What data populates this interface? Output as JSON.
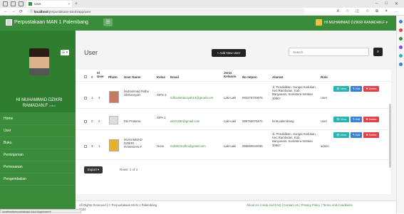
{
  "browser": {
    "tab_title": "User",
    "url_host": "localhost",
    "url_path": "/perpustakaan-tokoh/app/user",
    "win_controls": [
      "–",
      "□",
      "✕"
    ]
  },
  "header": {
    "brand": "Perpustakaan MAN 1 Palembang",
    "menu_toggle": "☰",
    "user": "HI MUHAMMAD DZIKRI RAMADAN.F ▾"
  },
  "sidebar": {
    "profile_button": "☰ ▾",
    "profile_name": "HI MUHAMMAD DZIKRI RAMADAN.F",
    "status": "online",
    "items": [
      "Home",
      "User",
      "Buku",
      "Peminjaman",
      "Pemesanan",
      "Pengembalian"
    ]
  },
  "main": {
    "title": "User",
    "add_button": "+ Add New User",
    "search_placeholder": "Search",
    "search_icon": "🔍",
    "columns": [
      "#",
      "Id User",
      "Photo",
      "User Name",
      "Kelas",
      "Email",
      "Jenis Kelamin",
      "No telpon",
      "Alamat",
      "Role"
    ],
    "rows": [
      {
        "no": "1",
        "id": "3",
        "username": "Muhammad Ridho Oktriansyah",
        "kelas": "XIPS 3",
        "email": "ridhooktriansyah13@gmail.com",
        "gender": "Laki-Laki",
        "phone": "082278700076",
        "alamat": "Jl. Pendidikan, Sungai Kedukan, Kec.Rambutan, Kab. Banyuasin, Sumatera Selatan 30967",
        "role": "User"
      },
      {
        "no": "2",
        "id": "2",
        "username": "Eki Pratama",
        "kelas": "XIPA 1",
        "email": "eki01382@gmail.com",
        "gender": "Laki-Laki",
        "phone": "089758076574",
        "alamat": "km9 palembang",
        "role": "User"
      },
      {
        "no": "3",
        "id": "1",
        "username": "MUHAMMAD DZIKRI RAMADAN.F",
        "kelas": "None",
        "email": "mdzikrirmdhn@gmail.com",
        "gender": "Laki-Laki",
        "phone": "085669516035",
        "alamat": "Jl. Pendidikan, Sungai Kedukan, Kec.Rambutan, Kab. Banyuasin, Sumatera Selatan 30967",
        "role": "admin"
      }
    ],
    "actions": {
      "view": "👁 View",
      "edit": "✎ Edit",
      "delete": "✖ Delete"
    },
    "export": "Export ▾",
    "rows_info": "Rows: 1 of 3"
  },
  "footer": {
    "copyright": "All Rights Reserved | © Perpustakaan MAN 1 Palembang 2024",
    "links": "About Us | Help And FAQ | Contact Us | Privacy Policy | Terms And Conditions"
  },
  "status_url": "localhost/perpustakaan-tokoh/app/user/#"
}
